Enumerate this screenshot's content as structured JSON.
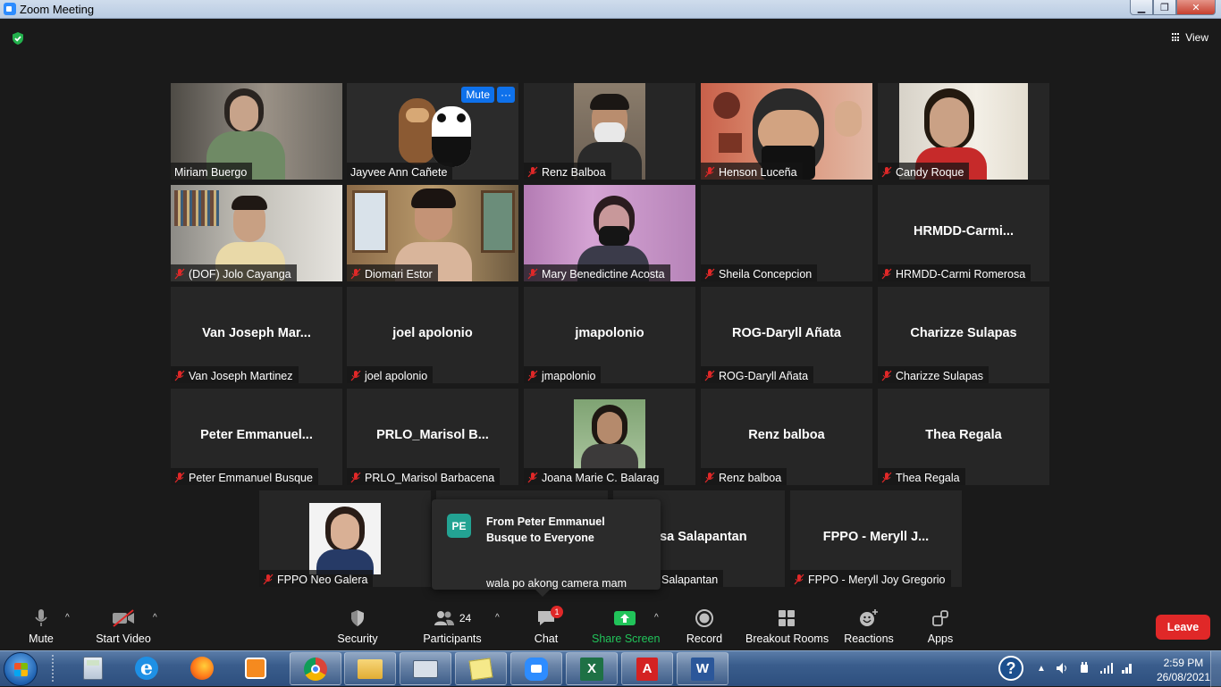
{
  "window": {
    "title": "Zoom Meeting"
  },
  "top": {
    "view_label": "View"
  },
  "tiles": [
    {
      "id": "miriam",
      "name": "Miriam Buergo"
    },
    {
      "id": "jayvee",
      "name": "Jayvee Ann Cañete",
      "mute_label": "Mute",
      "more_label": "···"
    },
    {
      "id": "renz",
      "name": "Renz Balboa"
    },
    {
      "id": "henson",
      "name": "Henson Luceña"
    },
    {
      "id": "candy",
      "name": "Candy Roque"
    },
    {
      "id": "jolo",
      "name": "(DOF) Jolo Cayanga"
    },
    {
      "id": "diomari",
      "name": "Diomari Estor"
    },
    {
      "id": "mary",
      "name": "Mary Benedictine Acosta"
    },
    {
      "id": "sheila",
      "name": "Sheila Concepcion"
    },
    {
      "id": "carmi",
      "name": "HRMDD-Carmi Romerosa",
      "display": "HRMDD-Carmi..."
    },
    {
      "id": "van",
      "name": "Van Joseph Martinez",
      "display": "Van Joseph Mar..."
    },
    {
      "id": "joel",
      "name": "joel apolonio",
      "display": "joel apolonio"
    },
    {
      "id": "jmap",
      "name": "jmapolonio",
      "display": "jmapolonio"
    },
    {
      "id": "rog",
      "name": "ROG-Daryll Añata",
      "display": "ROG-Daryll Añata"
    },
    {
      "id": "charizze",
      "name": "Charizze Sulapas",
      "display": "Charizze Sulapas"
    },
    {
      "id": "peter",
      "name": "Peter Emmanuel  Busque",
      "display": "Peter  Emmanuel..."
    },
    {
      "id": "prlo",
      "name": "PRLO_Marisol Barbacena",
      "display": "PRLO_Marisol  B..."
    },
    {
      "id": "joana",
      "name": "Joana Marie C. Balarag"
    },
    {
      "id": "renz2",
      "name": "Renz balboa",
      "display": "Renz balboa"
    },
    {
      "id": "thea",
      "name": "Thea Regala",
      "display": "Thea Regala"
    },
    {
      "id": "neo",
      "name": "FPPO Neo Galera"
    },
    {
      "id": "hidden1",
      "name": ""
    },
    {
      "id": "salapantan",
      "name": "Salapantan",
      "display": "ssa Salapantan"
    },
    {
      "id": "meryll",
      "name": "FPPO - Meryll Joy Gregorio",
      "display": "FPPO  - Meryll J..."
    }
  ],
  "chat_popup": {
    "avatar_initials": "PE",
    "from": "From Peter Emmanuel Busque to Everyone",
    "message": "wala po akong camera mam"
  },
  "toolbar": {
    "mute": "Mute",
    "start_video": "Start Video",
    "security": "Security",
    "participants": "Participants",
    "participants_count": "24",
    "chat": "Chat",
    "chat_badge": "1",
    "share_screen": "Share Screen",
    "record": "Record",
    "breakout_rooms": "Breakout Rooms",
    "reactions": "Reactions",
    "apps": "Apps",
    "leave": "Leave"
  },
  "taskbar": {
    "time": "2:59 PM",
    "date": "26/08/2021"
  },
  "colors": {
    "active_speaker_border": "#d6e36a",
    "leave_red": "#e02828",
    "zoom_blue": "#0e71eb",
    "share_green": "#21c45a"
  }
}
